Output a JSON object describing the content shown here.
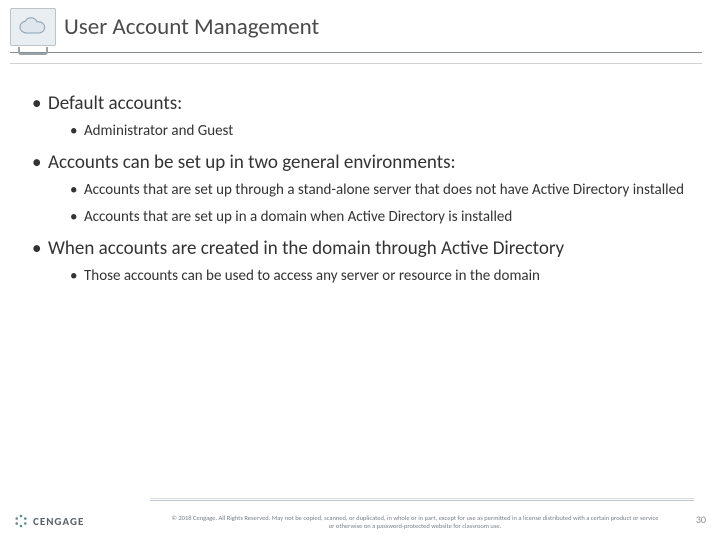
{
  "header": {
    "title": "User Account Management"
  },
  "bullets": [
    {
      "text": "Default accounts:",
      "sub": [
        "Administrator and Guest"
      ]
    },
    {
      "text": "Accounts can be set up in two general environments:",
      "sub": [
        "Accounts that are set up through a stand-alone server that does not have Active Directory installed",
        "Accounts that are set up in a domain when Active Directory is installed"
      ]
    },
    {
      "text": "When accounts are created in the domain through Active Directory",
      "sub": [
        "Those accounts can be used to access any server or resource in the domain"
      ]
    }
  ],
  "footer": {
    "brand": "CENGAGE",
    "copyright": "© 2018 Cengage. All Rights Reserved. May not be copied, scanned, or duplicated, in whole or in part, except for use as permitted in a license distributed with a certain product or service or otherwise on a password-protected website for classroom use.",
    "page": "30"
  }
}
